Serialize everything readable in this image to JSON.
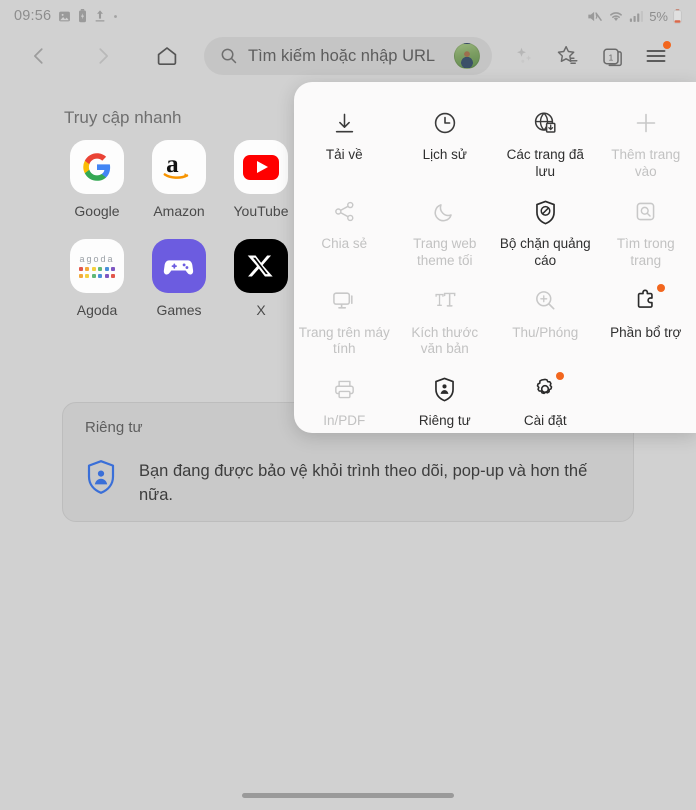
{
  "status_bar": {
    "time": "09:56",
    "battery_percent": "5%",
    "left_icons": [
      "gallery-icon",
      "battery-saver-icon",
      "upload-icon",
      "dot-icon"
    ],
    "right_icons": [
      "mute-icon",
      "wifi-icon",
      "signal-icon",
      "battery-icon"
    ]
  },
  "toolbar": {
    "back_label": "back-arrow",
    "forward_label": "forward-arrow",
    "home_label": "home",
    "url_placeholder": "Tìm kiếm hoặc nhập URL",
    "avatar_label": "profile-avatar",
    "ai_label": "ai-assistant",
    "bookmarks_label": "bookmarks",
    "tabs_count": "1",
    "menu_label": "menu",
    "menu_has_badge": true
  },
  "home": {
    "quick_access_title": "Truy cập nhanh",
    "tiles": [
      {
        "label": "Google",
        "icon": "google-icon"
      },
      {
        "label": "Amazon",
        "icon": "amazon-icon"
      },
      {
        "label": "YouTube",
        "icon": "youtube-icon"
      },
      {
        "label": "Agoda",
        "icon": "agoda-icon"
      },
      {
        "label": "Games",
        "icon": "games-icon"
      },
      {
        "label": "X",
        "icon": "x-icon"
      }
    ],
    "privacy": {
      "title": "Riêng tư",
      "message": "Bạn đang được bảo vệ khỏi trình theo dõi, pop-up và hơn thế nữa.",
      "icon": "shield-person-icon"
    }
  },
  "menu": {
    "rows": [
      [
        {
          "label": "Tải về",
          "icon": "download-icon",
          "disabled": false,
          "badge": false
        },
        {
          "label": "Lịch sử",
          "icon": "clock-icon",
          "disabled": false,
          "badge": false
        },
        {
          "label": "Các trang đã lưu",
          "icon": "globe-save-icon",
          "disabled": false,
          "badge": false
        },
        {
          "label": "Thêm trang vào",
          "icon": "plus-icon",
          "disabled": true,
          "badge": false
        }
      ],
      [
        {
          "label": "Chia sẻ",
          "icon": "share-icon",
          "disabled": true,
          "badge": false
        },
        {
          "label": "Trang web theme tối",
          "icon": "moon-icon",
          "disabled": true,
          "badge": false
        },
        {
          "label": "Bộ chặn quảng cáo",
          "icon": "ad-block-icon",
          "disabled": false,
          "badge": false
        },
        {
          "label": "Tìm trong trang",
          "icon": "find-in-page-icon",
          "disabled": true,
          "badge": false
        }
      ],
      [
        {
          "label": "Trang trên máy tính",
          "icon": "desktop-site-icon",
          "disabled": true,
          "badge": false
        },
        {
          "label": "Kích thước văn bản",
          "icon": "text-size-icon",
          "disabled": true,
          "badge": false
        },
        {
          "label": "Thu/Phóng",
          "icon": "zoom-icon",
          "disabled": true,
          "badge": false
        },
        {
          "label": "Phần bổ trợ",
          "icon": "extensions-icon",
          "disabled": false,
          "badge": true
        }
      ],
      [
        {
          "label": "In/PDF",
          "icon": "print-icon",
          "disabled": true,
          "badge": false
        },
        {
          "label": "Riêng tư",
          "icon": "shield-person-icon",
          "disabled": false,
          "badge": false
        },
        {
          "label": "Cài đặt",
          "icon": "gear-icon",
          "disabled": false,
          "badge": true
        }
      ]
    ]
  },
  "colors": {
    "page_background": "#d1d1d1",
    "panel_background": "#fbfafa",
    "url_bar": "#c5c5c5",
    "badge_orange": "#f2661e",
    "privacy_shield_blue": "#3a6fd8",
    "card_background": "#c9c9c9",
    "text_primary": "#2f2f2f",
    "text_disabled": "#c2c2c2"
  }
}
